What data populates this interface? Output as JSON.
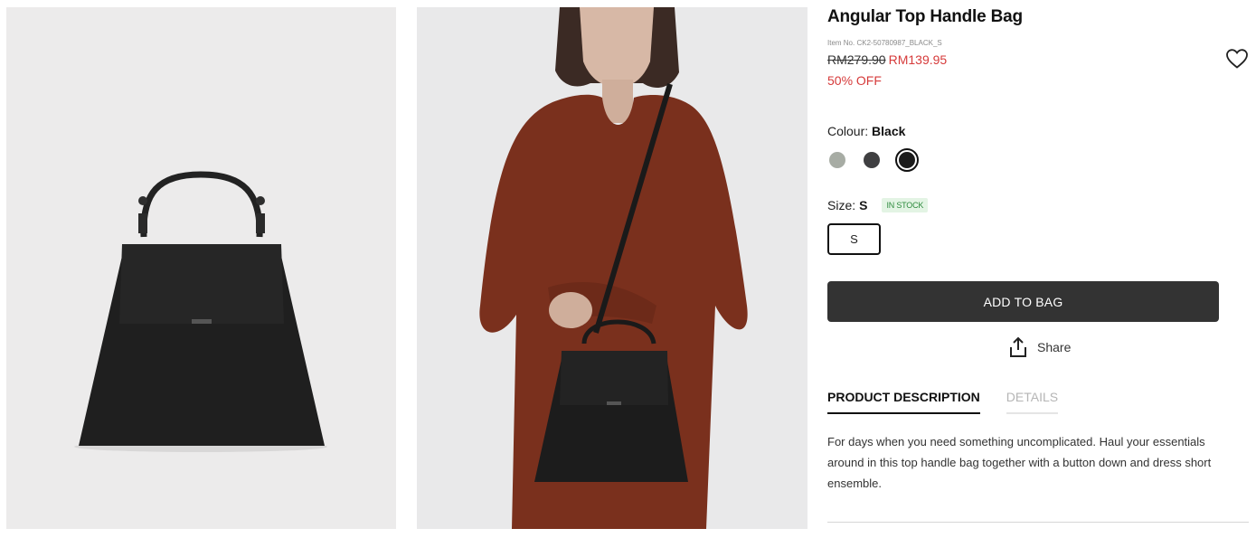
{
  "product": {
    "title": "Angular Top Handle Bag",
    "item_no": "Item No. CK2-50780987_BLACK_S",
    "old_price": "RM279.90",
    "new_price": "RM139.95",
    "discount": "50% OFF"
  },
  "icons": {
    "wishlist": "heart-outline-icon",
    "share": "share-upload-icon"
  },
  "colour": {
    "label": "Colour:",
    "selected": "Black",
    "swatches": [
      {
        "name": "sage",
        "color": "#a7aca4"
      },
      {
        "name": "dark-grey",
        "color": "#3f3f41"
      },
      {
        "name": "black",
        "color": "#1b1b1b"
      }
    ]
  },
  "size": {
    "label": "Size:",
    "selected": "S",
    "stock": "IN STOCK",
    "options": [
      "S"
    ]
  },
  "actions": {
    "add_to_bag": "ADD TO BAG",
    "share": "Share"
  },
  "tabs": [
    {
      "label": "PRODUCT DESCRIPTION",
      "active": true
    },
    {
      "label": "DETAILS",
      "active": false
    }
  ],
  "description": "For days when you need something uncomplicated. Haul your essentials around in this top handle bag together with a button down and dress short ensemble.",
  "colors": {
    "price_red": "#d63a3a",
    "button_dark": "#333333",
    "stock_green": "#2e8b3e"
  }
}
